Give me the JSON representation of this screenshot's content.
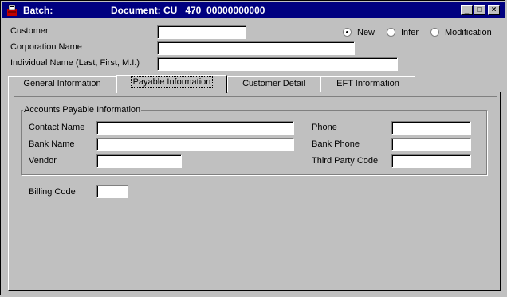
{
  "titlebar": {
    "app_label": "Batch:",
    "document_label": "Document: CU   470  00000000000",
    "minimize": "_",
    "maximize": "□",
    "close": "×"
  },
  "header": {
    "customer_label": "Customer",
    "customer_value": "",
    "corporation_label": "Corporation Name",
    "corporation_value": "",
    "individual_label": "Individual Name (Last, First, M.I.)",
    "individual_value": "",
    "mode": {
      "options": [
        "New",
        "Infer",
        "Modification"
      ],
      "selected": "New"
    }
  },
  "tabs": [
    {
      "label": "General Information",
      "active": false
    },
    {
      "label": "Payable Information",
      "active": true
    },
    {
      "label": "Customer Detail",
      "active": false
    },
    {
      "label": "EFT Information",
      "active": false
    }
  ],
  "payable": {
    "group_title": "Accounts Payable Information",
    "contact_name_label": "Contact Name",
    "contact_name_value": "",
    "bank_name_label": "Bank Name",
    "bank_name_value": "",
    "vendor_label": "Vendor",
    "vendor_value": "",
    "phone_label": "Phone",
    "phone_value": "",
    "bank_phone_label": "Bank Phone",
    "bank_phone_value": "",
    "third_party_label": "Third Party Code",
    "third_party_value": "",
    "billing_code_label": "Billing Code",
    "billing_code_value": ""
  }
}
